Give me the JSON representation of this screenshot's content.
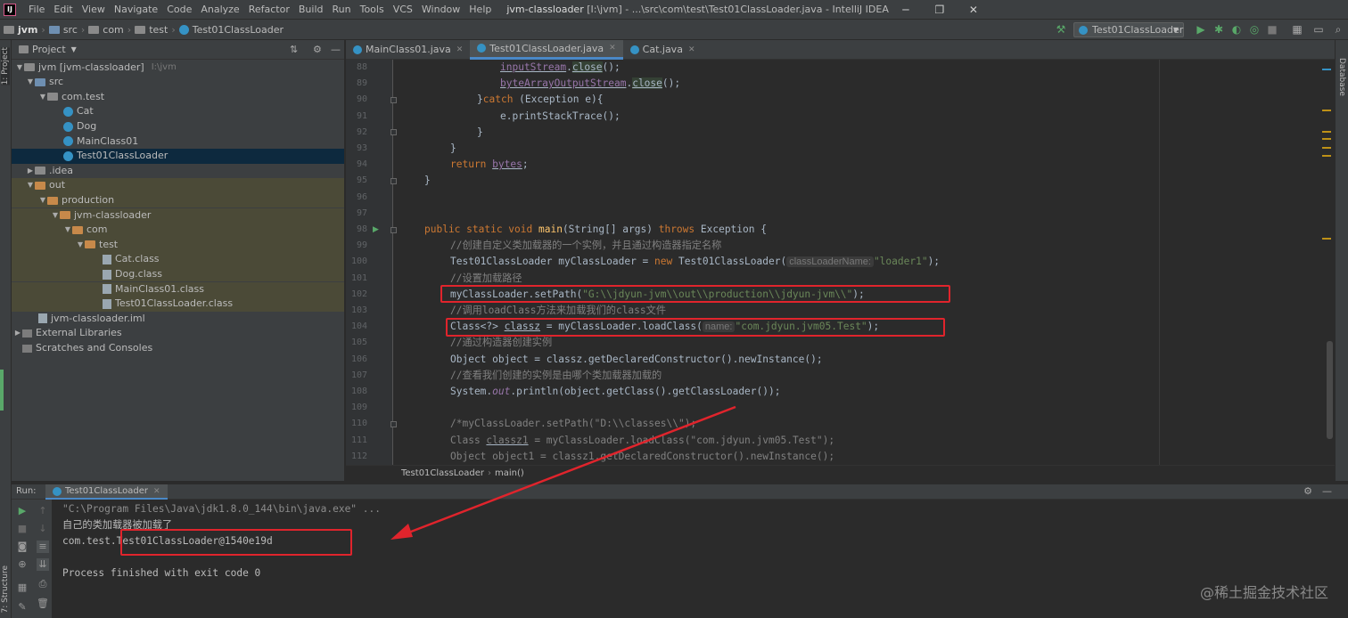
{
  "window": {
    "title_project": "jvm-classloader",
    "title_rest": " [I:\\jvm] - ...\\src\\com\\test\\Test01ClassLoader.java - IntelliJ IDEA",
    "menu": [
      "File",
      "Edit",
      "View",
      "Navigate",
      "Code",
      "Analyze",
      "Refactor",
      "Build",
      "Run",
      "Tools",
      "VCS",
      "Window",
      "Help"
    ]
  },
  "breadcrumb": [
    "jvm",
    "src",
    "com",
    "test",
    "Test01ClassLoader"
  ],
  "run_config": "Test01ClassLoader",
  "left_tool_strip": {
    "project": "1: Project",
    "structure": "7: Structure"
  },
  "right_tool_strip": {
    "database": "Database"
  },
  "project_panel": {
    "header": "Project",
    "items": [
      {
        "label": "jvm [jvm-classloader]",
        "suffix": "I:\\jvm"
      },
      {
        "label": "src"
      },
      {
        "label": "com.test"
      },
      {
        "label": "Cat"
      },
      {
        "label": "Dog"
      },
      {
        "label": "MainClass01"
      },
      {
        "label": "Test01ClassLoader"
      },
      {
        "label": ".idea"
      },
      {
        "label": "out"
      },
      {
        "label": "production"
      },
      {
        "label": "jvm-classloader"
      },
      {
        "label": "com"
      },
      {
        "label": "test"
      },
      {
        "label": "Cat.class"
      },
      {
        "label": "Dog.class"
      },
      {
        "label": "MainClass01.class"
      },
      {
        "label": "Test01ClassLoader.class"
      },
      {
        "label": "jvm-classloader.iml"
      },
      {
        "label": "External Libraries"
      },
      {
        "label": "Scratches and Consoles"
      }
    ]
  },
  "editor_tabs": [
    "MainClass01.java",
    "Test01ClassLoader.java",
    "Cat.java"
  ],
  "editor": {
    "line_numbers": [
      "88",
      "89",
      "90",
      "91",
      "92",
      "93",
      "94",
      "95",
      "96",
      "97",
      "98",
      "99",
      "100",
      "101",
      "102",
      "103",
      "104",
      "105",
      "106",
      "107",
      "108",
      "109",
      "110",
      "111",
      "112"
    ],
    "hints": {
      "class_loader_name": "classLoaderName:",
      "name": "name:"
    },
    "tokens": {
      "l88_a": "inputStream",
      "l88_b": ".",
      "l88_c": "close",
      "l88_d": "();",
      "l89_a": "byteArrayOutputStream",
      "l89_b": ".",
      "l89_c": "close",
      "l89_d": "();",
      "l90_a": "}",
      "l90_b": "catch",
      "l90_c": " (Exception e){",
      "l91": "e.printStackTrace();",
      "l92": "}",
      "l93": "}",
      "l94_a": "return ",
      "l94_b": "bytes",
      "l94_c": ";",
      "l95": "}",
      "l98_a": "public static void ",
      "l98_b": "main",
      "l98_c": "(String[] args) ",
      "l98_d": "throws",
      "l98_e": " Exception {",
      "l99": "//创建自定义类加载器的一个实例，并且通过构造器指定名称",
      "l100_a": "Test01ClassLoader myClassLoader = ",
      "l100_b": "new",
      "l100_c": " Test01ClassLoader(",
      "l100_d": "\"loader1\"",
      "l100_e": ");",
      "l101": "//设置加载路径",
      "l102_a": "myClassLoader.setPath(",
      "l102_b": "\"G:\\\\jdyun-jvm\\\\out\\\\production\\\\jdyun-jvm\\\\\"",
      "l102_c": ");",
      "l103": "//调用loadClass方法来加载我们的class文件",
      "l104_a": "Class<?> ",
      "l104_b": "classz",
      "l104_c": " = myClassLoader.loadClass(",
      "l104_d": "\"com.jdyun.jvm05.Test\"",
      "l104_e": ");",
      "l105": "//通过构造器创建实例",
      "l106": "Object object = classz.getDeclaredConstructor().newInstance();",
      "l107": "//查看我们创建的实例是由哪个类加载器加载的",
      "l108_a": "System.",
      "l108_b": "out",
      "l108_c": ".println(object.getClass().getClassLoader());",
      "l110": "/*myClassLoader.setPath(\"D:\\\\classes\\\\\");",
      "l111_a": "Class ",
      "l111_b": "classz1",
      "l111_c": " = myClassLoader.loadClass(\"com.jdyun.jvm05.Test\");",
      "l112": "Object object1 = classz1.getDeclaredConstructor().newInstance();"
    },
    "breadcrumb": [
      "Test01ClassLoader",
      "main()"
    ]
  },
  "run_panel": {
    "label": "Run:",
    "tab": "Test01ClassLoader",
    "output": [
      "\"C:\\Program Files\\Java\\jdk1.8.0_144\\bin\\java.exe\" ...",
      "自己的类加载器被加载了",
      "com.test.Test01ClassLoader@1540e19d",
      "",
      "Process finished with exit code 0"
    ]
  },
  "watermark": "@稀土掘金技术社区",
  "colors": {
    "annotation_red": "#e0242c",
    "selection": "#0d293e",
    "tab_underline": "#4a88c7"
  }
}
